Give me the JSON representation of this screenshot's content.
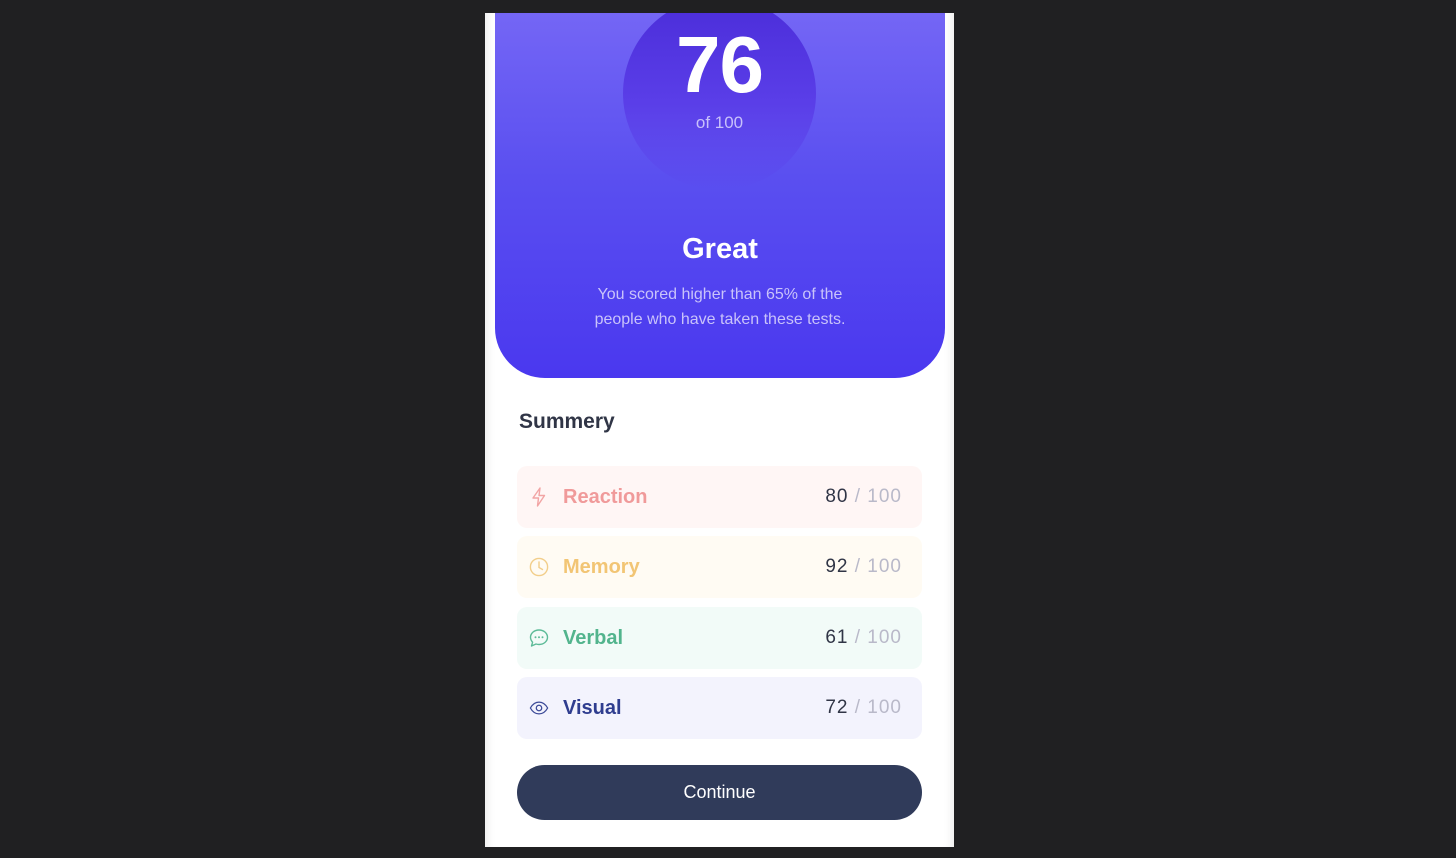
{
  "result": {
    "score": "76",
    "score_of": "of 100",
    "rating": "Great",
    "description": "You scored higher than 65% of the people who have taken these tests."
  },
  "summary": {
    "title": "Summery",
    "items": [
      {
        "label": "Reaction",
        "score": "80",
        "max": " / 100",
        "icon": "lightning-icon",
        "color": "#f25c5c",
        "bg": "#fff6f5"
      },
      {
        "label": "Memory",
        "score": "92",
        "max": " / 100",
        "icon": "clock-icon",
        "color": "#f2bb5c",
        "bg": "#fffbf3"
      },
      {
        "label": "Verbal",
        "score": "61",
        "max": " / 100",
        "icon": "chat-bubble-icon",
        "color": "#3aa67f",
        "bg": "#f2fbf8"
      },
      {
        "label": "Visual",
        "score": "72",
        "max": " / 100",
        "icon": "eye-icon",
        "color": "#2a3a8f",
        "bg": "#f3f3fd"
      }
    ]
  },
  "actions": {
    "continue_label": "Continue"
  }
}
